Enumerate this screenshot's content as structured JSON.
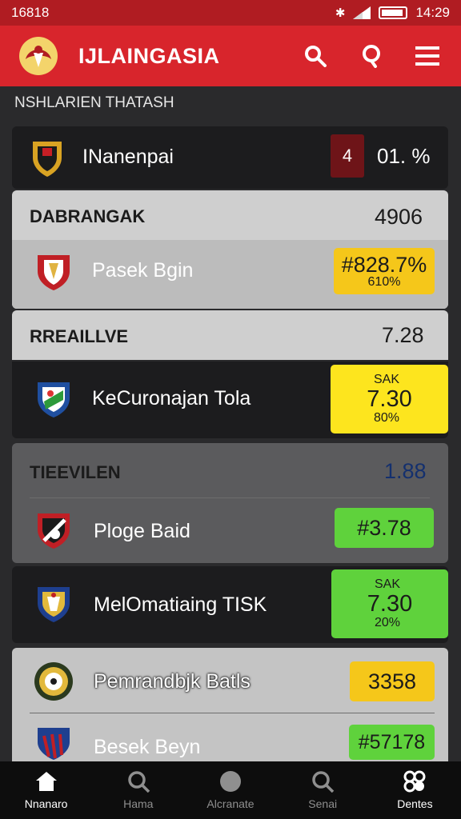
{
  "status_bar": {
    "left_text": "16818",
    "time": "14:29"
  },
  "app_bar": {
    "title": "IJLAINGASIA"
  },
  "section": {
    "label": "NSHLARIEN THATASH"
  },
  "featured": {
    "team": "INanenpai",
    "badge": "4",
    "value": "01. %"
  },
  "groups": [
    {
      "header": "DABRANGAK",
      "header_value": "4906",
      "match": {
        "team": "Pasek Bgin",
        "odds_main": "#828.7%",
        "odds_sub": "610%"
      }
    },
    {
      "header": "RREAILLVE",
      "header_value": "7.28",
      "match": {
        "team": "KeCuronajan Tola",
        "odds_top": "SAK",
        "odds_main": "7.30",
        "odds_sub": "80%"
      }
    },
    {
      "header": "TIEEVILEN",
      "header_value": "1.88",
      "match": {
        "team": "Ploge Baid",
        "odds_main": "#3.78"
      }
    },
    {
      "match": {
        "team": "MelOmatiaing TISK",
        "odds_top": "SAK",
        "odds_main": "7.30",
        "odds_sub": "20%"
      }
    },
    {
      "matches": [
        {
          "team": "Pemrandbjk Batls",
          "odds_main": "3358"
        },
        {
          "team": "Besek Beyn",
          "odds_main": "#57178"
        }
      ]
    }
  ],
  "bottom_nav": [
    {
      "label": "Nnanaro",
      "icon": "home-icon",
      "active": true
    },
    {
      "label": "Hama",
      "icon": "search-icon",
      "active": false
    },
    {
      "label": "Alcranate",
      "icon": "circle-icon",
      "active": false
    },
    {
      "label": "Senai",
      "icon": "search-icon",
      "active": false
    },
    {
      "label": "Dentes",
      "icon": "more-icon",
      "active": true
    }
  ],
  "colors": {
    "brand_red": "#d8252c",
    "status_red": "#b01c22",
    "odds_yellow": "#f5c71a",
    "odds_green": "#5fd23c",
    "background": "#2a2a2c"
  }
}
